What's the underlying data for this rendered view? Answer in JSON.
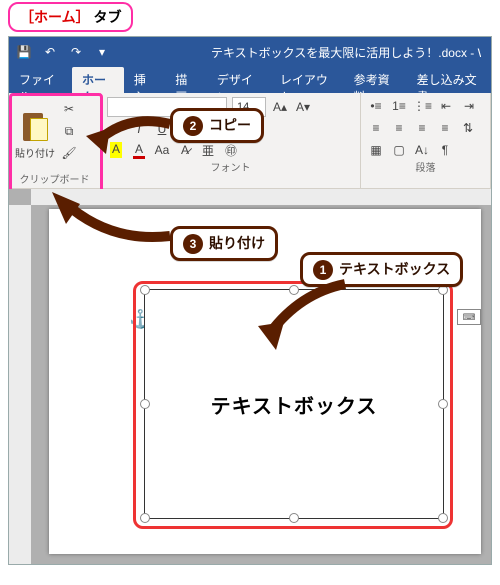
{
  "top_callout": {
    "bracket_open": "［",
    "label": "ホーム",
    "bracket_close": "］",
    "suffix": " タブ"
  },
  "titlebar": {
    "doc_title": "テキストボックスを最大限に活用しよう！.docx - Wo"
  },
  "tabs": {
    "file": "ファイル",
    "home": "ホーム",
    "insert": "挿入",
    "draw": "描画",
    "design": "デザイン",
    "layout": "レイアウト",
    "references": "参考資料",
    "mailings": "差し込み文書"
  },
  "ribbon": {
    "clipboard": {
      "paste_label": "貼り付け",
      "group_label": "クリップボード"
    },
    "font": {
      "size_value": "14",
      "group_label": "フォント"
    },
    "paragraph": {
      "group_label": "段落"
    }
  },
  "callouts": {
    "copy": "コピー",
    "paste": "貼り付け",
    "textbox": "テキストボックス"
  },
  "document": {
    "textbox_text": "テキストボックス"
  }
}
